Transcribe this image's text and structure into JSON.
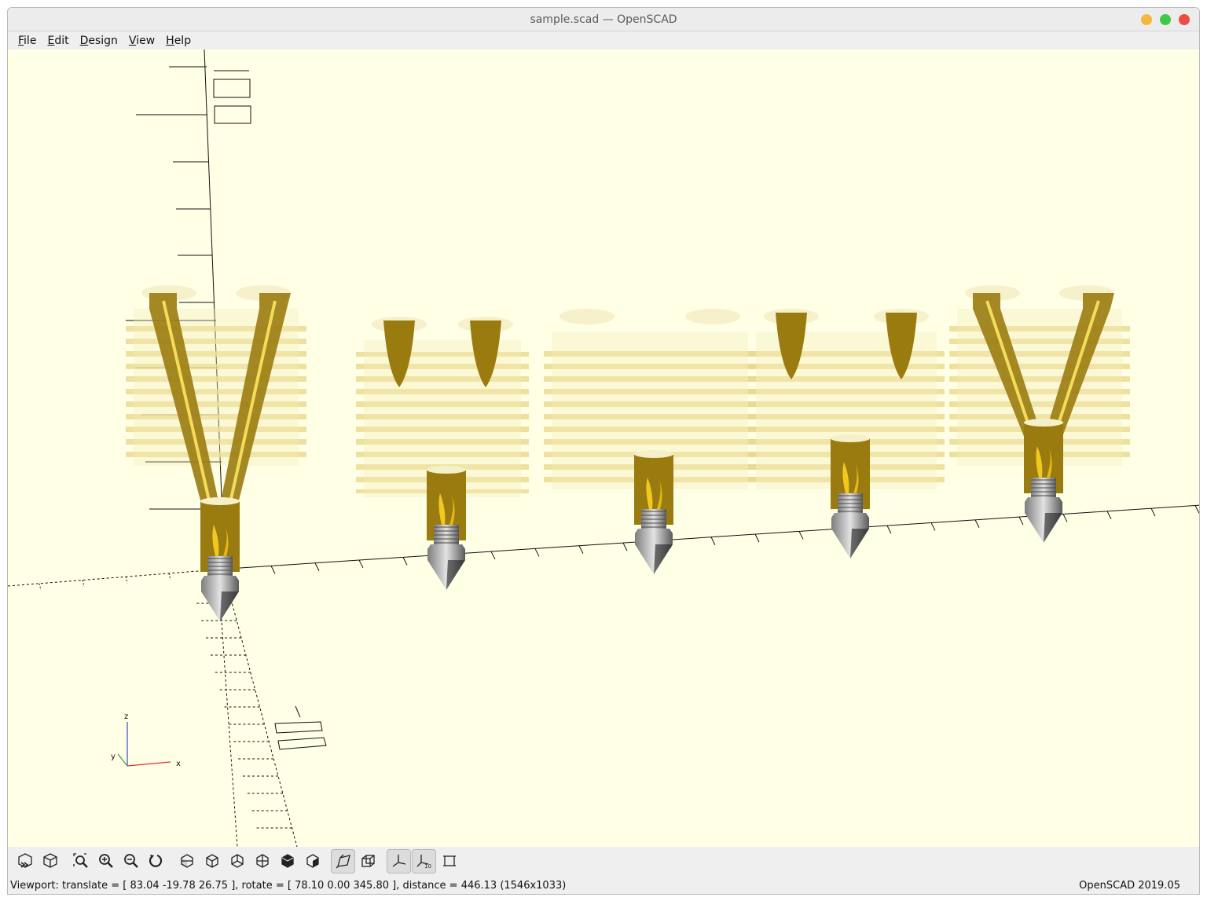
{
  "window": {
    "title": "sample.scad — OpenSCAD"
  },
  "menu": {
    "items": [
      {
        "mnemonic": "F",
        "rest": "ile"
      },
      {
        "mnemonic": "E",
        "rest": "dit"
      },
      {
        "mnemonic": "D",
        "rest": "esign"
      },
      {
        "mnemonic": "V",
        "rest": "iew"
      },
      {
        "mnemonic": "H",
        "rest": "elp"
      }
    ]
  },
  "viewport": {
    "background": "#ffffe5",
    "model_color": "#9a7b0f",
    "axis_labels": {
      "x": "x",
      "y": "y",
      "z": "z"
    },
    "scale_marker": "1"
  },
  "toolbar": {
    "buttons": [
      {
        "icon": "preview-icon",
        "active": false
      },
      {
        "icon": "render-icon",
        "active": false
      },
      {
        "icon": "view-all-icon",
        "active": false
      },
      {
        "icon": "zoom-in-icon",
        "active": false
      },
      {
        "icon": "zoom-out-icon",
        "active": false
      },
      {
        "icon": "reset-view-icon",
        "active": false
      },
      {
        "icon": "view-right-icon",
        "active": false
      },
      {
        "icon": "view-top-icon",
        "active": false
      },
      {
        "icon": "view-bottom-icon",
        "active": false
      },
      {
        "icon": "view-left-icon",
        "active": false
      },
      {
        "icon": "view-front-icon",
        "active": false
      },
      {
        "icon": "view-back-icon",
        "active": false
      },
      {
        "icon": "perspective-icon",
        "active": true
      },
      {
        "icon": "orthogonal-icon",
        "active": false
      },
      {
        "icon": "show-axes-icon",
        "active": true
      },
      {
        "icon": "show-scale-markers-icon",
        "active": true
      },
      {
        "icon": "show-edges-icon",
        "active": false
      }
    ]
  },
  "status": {
    "viewport_info": "Viewport: translate = [ 83.04 -19.78 26.75 ], rotate = [ 78.10 0.00 345.80 ], distance = 446.13 (1546x1033)",
    "version": "OpenSCAD 2019.05"
  }
}
